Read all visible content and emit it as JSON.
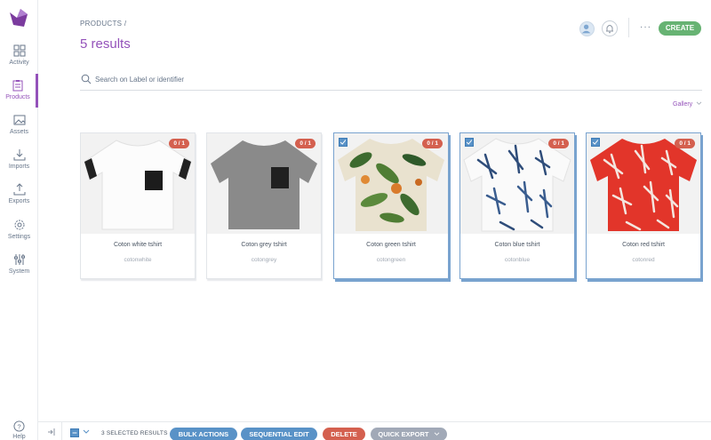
{
  "sidebar": {
    "items": [
      {
        "label": "Activity",
        "icon": "dashboard-icon"
      },
      {
        "label": "Products",
        "icon": "clipboard-icon",
        "active": true
      },
      {
        "label": "Assets",
        "icon": "image-icon"
      },
      {
        "label": "Imports",
        "icon": "import-icon"
      },
      {
        "label": "Exports",
        "icon": "export-icon"
      },
      {
        "label": "Settings",
        "icon": "gear-icon"
      },
      {
        "label": "System",
        "icon": "sliders-icon"
      }
    ],
    "help_label": "Help"
  },
  "header": {
    "breadcrumb": "PRODUCTS /",
    "title": "5 results",
    "more_label": "···",
    "create_label": "CREATE"
  },
  "search": {
    "placeholder": "Search on Label or identifier",
    "value": ""
  },
  "view_selector": {
    "label": "Gallery"
  },
  "products": [
    {
      "name": "Coton white tshirt",
      "code": "cotonwhite",
      "completeness": "0 / 1",
      "selected": false
    },
    {
      "name": "Coton grey tshirt",
      "code": "cotongrey",
      "completeness": "0 / 1",
      "selected": false
    },
    {
      "name": "Coton green tshirt",
      "code": "cotongreen",
      "completeness": "0 / 1",
      "selected": true
    },
    {
      "name": "Coton blue tshirt",
      "code": "cotonblue",
      "completeness": "0 / 1",
      "selected": true
    },
    {
      "name": "Coton red tshirt",
      "code": "cotonred",
      "completeness": "0 / 1",
      "selected": true
    }
  ],
  "bottom_bar": {
    "selected_count": "3 SELECTED RESULTS",
    "bulk_actions": "BULK ACTIONS",
    "sequential_edit": "SEQUENTIAL EDIT",
    "delete": "DELETE",
    "quick_export": "QUICK EXPORT"
  },
  "colors": {
    "brand": "#9452ba",
    "create": "#67b373",
    "primary": "#5992c7",
    "danger": "#d4604f",
    "neutral": "#a1a9b7"
  }
}
